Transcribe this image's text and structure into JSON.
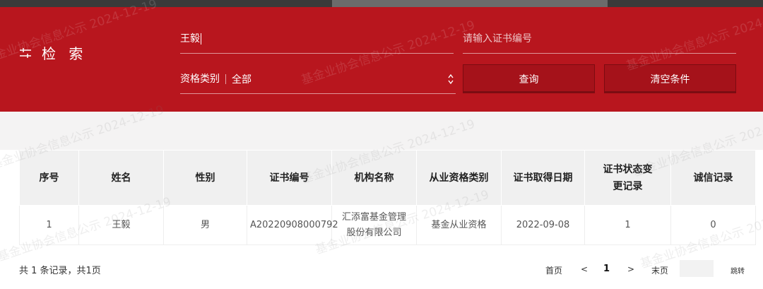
{
  "search": {
    "title": "检 索",
    "name_value": "王毅",
    "cert_placeholder": "请输入证书编号",
    "type_label": "资格类别",
    "type_value": "全部",
    "query_label": "查询",
    "clear_label": "清空条件"
  },
  "table": {
    "headers": [
      "序号",
      "姓名",
      "性别",
      "证书编号",
      "机构名称",
      "从业资格类别",
      "证书取得日期",
      "证书状态变更记录",
      "诚信记录"
    ],
    "rows": [
      [
        "1",
        "王毅",
        "男",
        "A20220908000792",
        "汇添富基金管理股份有限公司",
        "基金从业资格",
        "2022-09-08",
        "1",
        "0"
      ]
    ]
  },
  "footer": {
    "summary": "共 1 条记录，共1页",
    "first": "首页",
    "prev": "<",
    "current": "1",
    "next": ">",
    "last": "末页",
    "jump": "跳转"
  },
  "watermark": {
    "text": "基金业协会信息公示 2024-12-19"
  },
  "colors": {
    "banner": "#b8161e",
    "button": "#a5121a"
  }
}
